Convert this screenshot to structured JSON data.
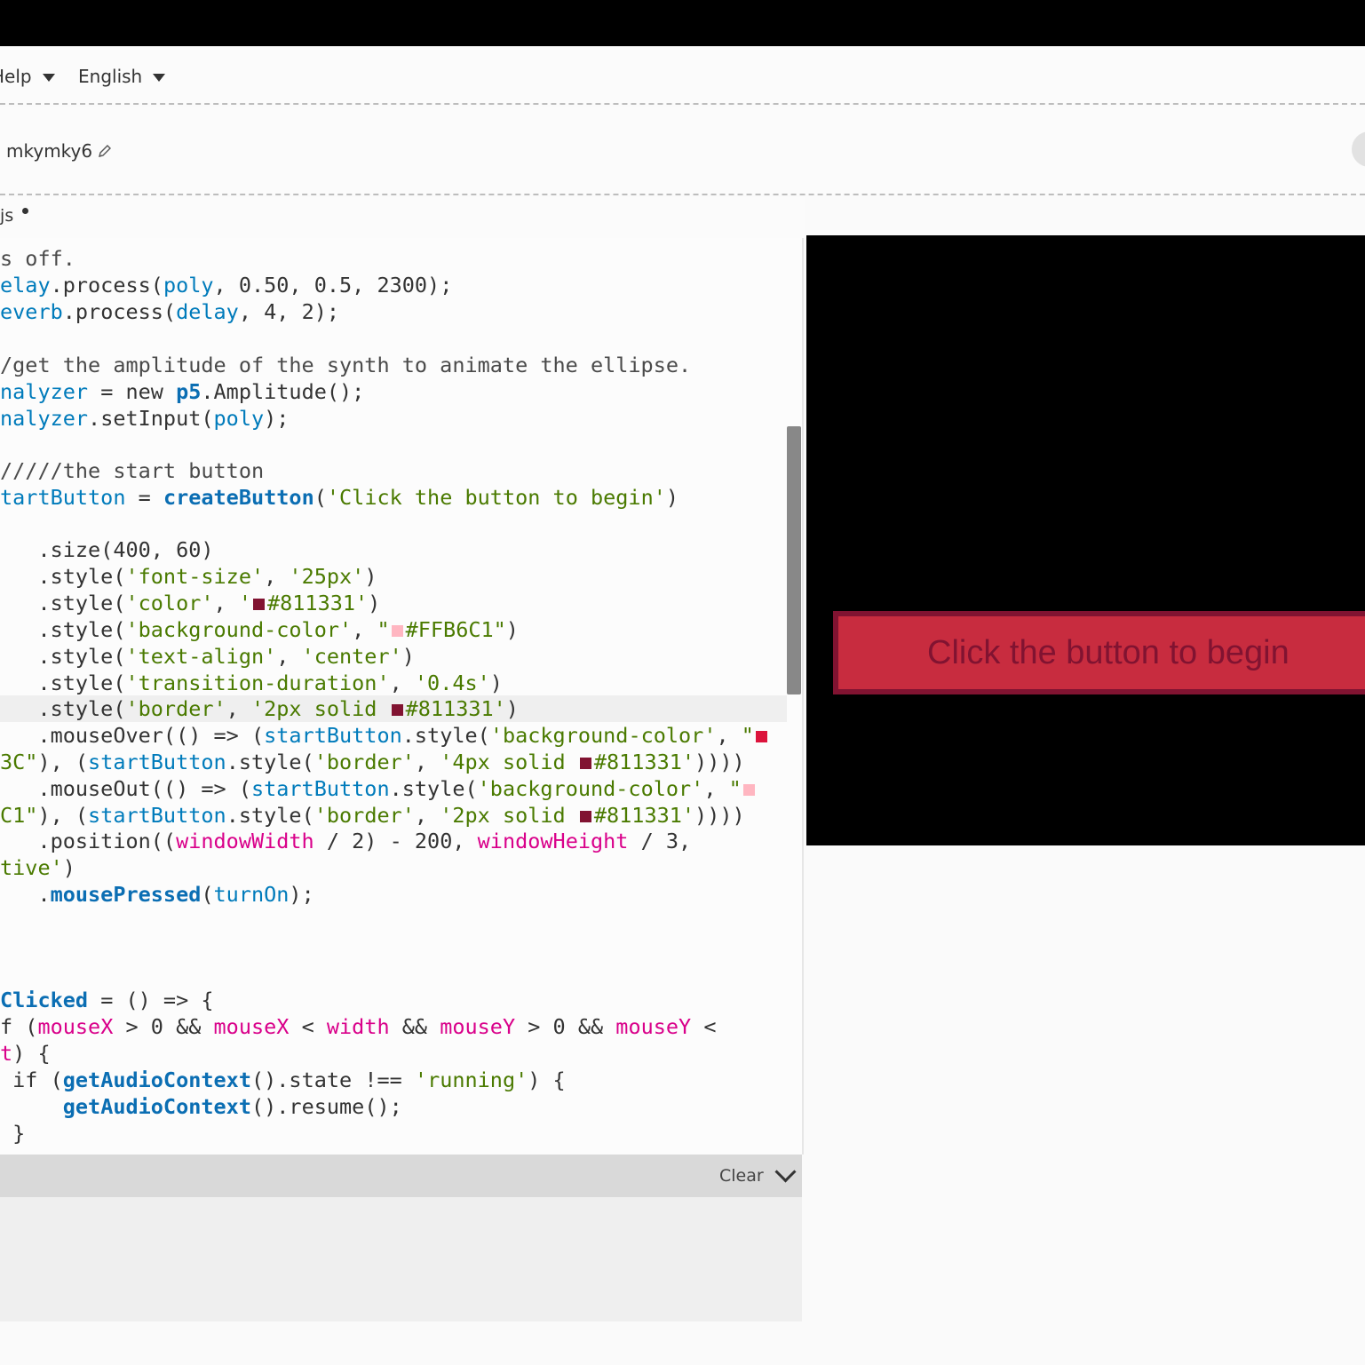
{
  "menubar": {
    "help_label": "Help",
    "language_label": "English"
  },
  "user": {
    "sketch_name": "mkymky6"
  },
  "tab": {
    "file_label": ".js"
  },
  "console": {
    "clear_label": "Clear"
  },
  "preview": {
    "button_label": "Click the button to begin",
    "button_bg": "#C82C3F",
    "button_text_color": "#811331"
  },
  "swatches": {
    "dark": "#811331",
    "pink": "#FFB6C1",
    "red": "#DC143C"
  },
  "code": {
    "l0": "s off.",
    "l1_a": "elay",
    "l1_b": ".process(",
    "l1_c": "poly",
    "l1_d": ", 0.50, 0.5, 2300);",
    "l2_a": "everb",
    "l2_b": ".process(",
    "l2_c": "delay",
    "l2_d": ", 4, 2);",
    "l4": "/get the amplitude of the synth to animate the ellipse.",
    "l5_a": "nalyzer",
    "l5_b": " = new ",
    "l5_c": "p5",
    "l5_d": ".Amplitude();",
    "l6_a": "nalyzer",
    "l6_b": ".setInput(",
    "l6_c": "poly",
    "l6_d": ");",
    "l8": "/////the start button",
    "l9_a": "tartButton",
    "l9_b": " = ",
    "l9_c": "createButton",
    "l9_d": "(",
    "l9_e": "'Click the button to begin'",
    "l9_f": ")",
    "l11": "   .size(400, 60)",
    "l12_a": "   .style(",
    "l12_b": "'font-size'",
    "l12_c": ", ",
    "l12_d": "'25px'",
    "l12_e": ")",
    "l13_a": "   .style(",
    "l13_b": "'color'",
    "l13_c": ", ",
    "l13_d": "'",
    "l13_e": "#811331'",
    "l13_f": ")",
    "l14_a": "   .style(",
    "l14_b": "'background-color'",
    "l14_c": ", ",
    "l14_d": "\"",
    "l14_e": "#FFB6C1\"",
    "l14_f": ")",
    "l15_a": "   .style(",
    "l15_b": "'text-align'",
    "l15_c": ", ",
    "l15_d": "'center'",
    "l15_e": ")",
    "l16_a": "   .style(",
    "l16_b": "'transition-duration'",
    "l16_c": ", ",
    "l16_d": "'0.4s'",
    "l16_e": ")",
    "l17_a": "   .style(",
    "l17_b": "'border'",
    "l17_c": ", ",
    "l17_d": "'2px solid ",
    "l17_e": "#811331'",
    "l17_f": ")",
    "l18_a": "   .mouseOver(() => (",
    "l18_b": "startButton",
    "l18_c": ".style(",
    "l18_d": "'background-color'",
    "l18_e": ", ",
    "l18_f": "\"",
    "l19_a": "3C\"",
    "l19_b": "), (",
    "l19_c": "startButton",
    "l19_d": ".style(",
    "l19_e": "'border'",
    "l19_f": ", ",
    "l19_g": "'4px solid ",
    "l19_h": "#811331'",
    "l19_i": "))))",
    "l20_a": "   .mouseOut(() => (",
    "l20_b": "startButton",
    "l20_c": ".style(",
    "l20_d": "'background-color'",
    "l20_e": ", ",
    "l20_f": "\"",
    "l21_a": "C1\"",
    "l21_b": "), (",
    "l21_c": "startButton",
    "l21_d": ".style(",
    "l21_e": "'border'",
    "l21_f": ", ",
    "l21_g": "'2px solid ",
    "l21_h": "#811331'",
    "l21_i": "))))",
    "l22_a": "   .position((",
    "l22_b": "windowWidth",
    "l22_c": " / 2) - 200, ",
    "l22_d": "windowHeight",
    "l22_e": " / 3,",
    "l23_a": "tive'",
    "l23_b": ")",
    "l24_a": "   .",
    "l24_b": "mousePressed",
    "l24_c": "(",
    "l24_d": "turnOn",
    "l24_e": ");",
    "l28_a": "Clicked",
    "l28_b": " = () => {",
    "l29_a": "f (",
    "l29_b": "mouseX",
    "l29_c": " > 0 && ",
    "l29_d": "mouseX",
    "l29_e": " < ",
    "l29_f": "width",
    "l29_g": " && ",
    "l29_h": "mouseY",
    "l29_i": " > 0 && ",
    "l29_j": "mouseY",
    "l29_k": " <",
    "l30_a": "t",
    "l30_b": ") {",
    "l31_a": " if (",
    "l31_b": "getAudioContext",
    "l31_c": "().state !== ",
    "l31_d": "'running'",
    "l31_e": ") {",
    "l32_a": "     ",
    "l32_b": "getAudioContext",
    "l32_c": "().resume();",
    "l33": " }"
  }
}
